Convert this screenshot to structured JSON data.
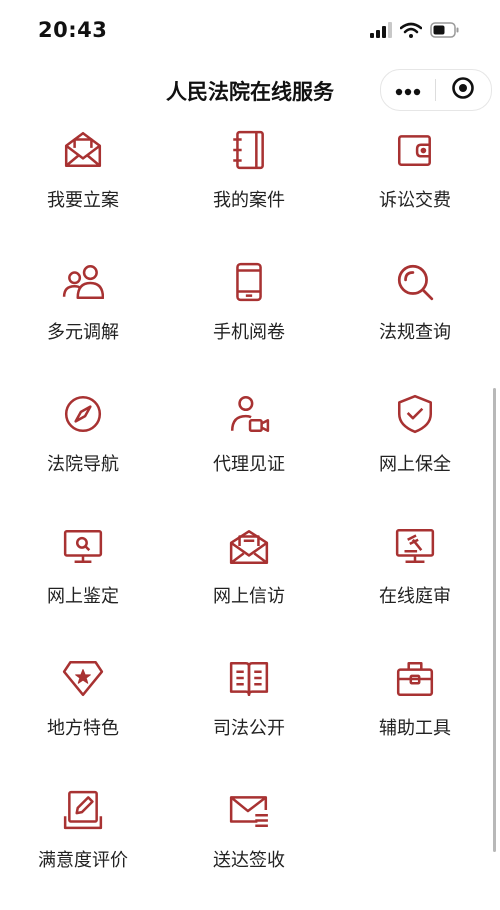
{
  "status_bar": {
    "time": "20:43"
  },
  "header": {
    "title": "人民法院在线服务"
  },
  "theme": {
    "accent": "#a83232"
  },
  "services": [
    {
      "label": "我要立案",
      "icon": "envelope-case-icon"
    },
    {
      "label": "我的案件",
      "icon": "notebook-icon"
    },
    {
      "label": "诉讼交费",
      "icon": "wallet-icon"
    },
    {
      "label": "多元调解",
      "icon": "people-icon"
    },
    {
      "label": "手机阅卷",
      "icon": "mobile-icon"
    },
    {
      "label": "法规查询",
      "icon": "search-icon"
    },
    {
      "label": "法院导航",
      "icon": "compass-icon"
    },
    {
      "label": "代理见证",
      "icon": "video-person-icon"
    },
    {
      "label": "网上保全",
      "icon": "shield-check-icon"
    },
    {
      "label": "网上鉴定",
      "icon": "monitor-search-icon"
    },
    {
      "label": "网上信访",
      "icon": "open-letter-icon"
    },
    {
      "label": "在线庭审",
      "icon": "monitor-gavel-icon"
    },
    {
      "label": "地方特色",
      "icon": "star-badge-icon"
    },
    {
      "label": "司法公开",
      "icon": "open-book-icon"
    },
    {
      "label": "辅助工具",
      "icon": "toolbox-icon"
    },
    {
      "label": "满意度评价",
      "icon": "edit-doc-icon"
    },
    {
      "label": "送达签收",
      "icon": "mail-list-icon"
    }
  ]
}
